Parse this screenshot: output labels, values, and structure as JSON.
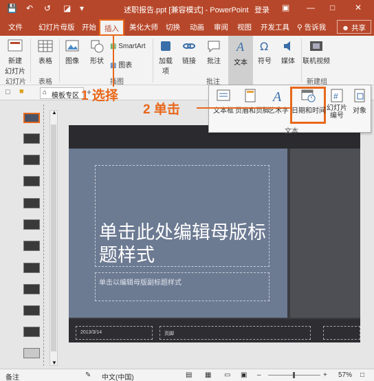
{
  "titlebar": {
    "title": "述职报告.ppt [兼容模式] - PowerPoint",
    "login": "登录",
    "accent": "#b7472a"
  },
  "tabs": {
    "file": "文件",
    "slide_master": "幻灯片母版",
    "home": "开始",
    "insert": "插入",
    "beautify": "美化大师",
    "transitions": "切换",
    "animations": "动画",
    "review": "审阅",
    "view": "视图",
    "developer": "开发工具",
    "tell_me": "告诉我",
    "share": "共享"
  },
  "ribbon": {
    "new_slide": "新建\n幻灯片",
    "table": "表格",
    "image": "图像",
    "shapes": "形状",
    "smartart": "SmartArt",
    "chart": "图表",
    "addins": "加载\n项",
    "links": "链接",
    "comment": "批注",
    "text": "文本",
    "symbols": "符号",
    "media": "媒体",
    "online_video": "联机视频",
    "groups": {
      "slides": "幻灯片",
      "tables": "表格",
      "illustrations": "插图",
      "comments": "批注",
      "new_group": "新建组"
    }
  },
  "subbar": {
    "template_tab": "模板专区"
  },
  "dropdown": {
    "textbox": "文本框",
    "header_footer": "页眉和页脚",
    "wordart": "艺术字",
    "datetime": "日期和时间",
    "slide_number": "幻灯片\n编号",
    "object": "对象",
    "group_label": "文本"
  },
  "annotations": {
    "step1": "1 选择",
    "step2": "2 单击",
    "color": "#e8671a"
  },
  "slide": {
    "title": "单击此处编辑母版标题样式",
    "subtitle": "单击以编辑母版副标题样式",
    "date_placeholder": "2013/3/14",
    "footer_placeholder": "页脚"
  },
  "status": {
    "notes": "备注",
    "language": "中文(中国)",
    "zoom": "57%"
  }
}
